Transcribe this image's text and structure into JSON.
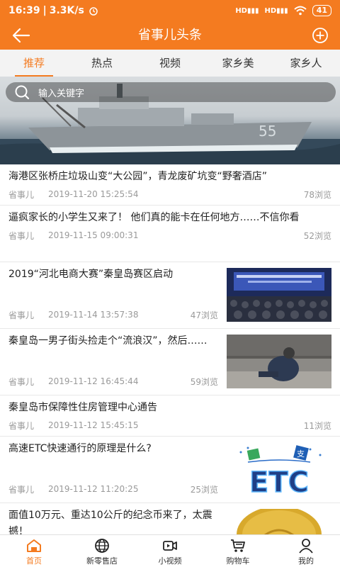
{
  "status": {
    "time": "16:39",
    "speed": "3.3K/s",
    "battery": "41"
  },
  "header": {
    "title": "省事儿头条"
  },
  "tabs": [
    {
      "label": "推荐",
      "active": true
    },
    {
      "label": "热点"
    },
    {
      "label": "视频"
    },
    {
      "label": "家乡美"
    },
    {
      "label": "家乡人"
    }
  ],
  "search": {
    "placeholder": "输入关键字"
  },
  "banner": {
    "ship_number": "55"
  },
  "news": [
    {
      "title": "海港区张桥庄垃圾山变“大公园”，青龙废矿坑变“野奢酒店”",
      "source": "省事儿",
      "date": "2019-11-20 15:25:54",
      "views": "78浏览"
    },
    {
      "title": "逼疯家长的小学生又来了！ 他们真的能卡在任何地方……不信你看",
      "source": "省事儿",
      "date": "2019-11-15 09:00:31",
      "views": "52浏览"
    },
    {
      "title": "2019“河北电商大赛”秦皇岛赛区启动",
      "source": "省事儿",
      "date": "2019-11-14 13:57:38",
      "views": "47浏览",
      "thumb": "conference"
    },
    {
      "title": "秦皇岛一男子街头捡走个“流浪汉”，然后……",
      "source": "省事儿",
      "date": "2019-11-12 16:45:44",
      "views": "59浏览",
      "thumb": "homeless"
    },
    {
      "title": "秦皇岛市保障性住房管理中心通告",
      "source": "省事儿",
      "date": "2019-11-12 15:45:15",
      "views": "11浏览"
    },
    {
      "title": "高速ETC快速通行的原理是什么?",
      "source": "省事儿",
      "date": "2019-11-12 11:20:25",
      "views": "25浏览",
      "thumb": "etc"
    },
    {
      "title": "面值10万元、重达10公斤的纪念币来了，太震撼！",
      "thumb": "coin"
    }
  ],
  "thumb_text": {
    "etc": "ETC",
    "etc_sign": "支"
  },
  "nav": [
    {
      "label": "首页",
      "icon": "home-icon",
      "active": true
    },
    {
      "label": "新零售店",
      "icon": "globe-icon"
    },
    {
      "label": "小视频",
      "icon": "video-icon"
    },
    {
      "label": "购物车",
      "icon": "cart-icon"
    },
    {
      "label": "我的",
      "icon": "user-icon"
    }
  ],
  "colors": {
    "accent": "#f47b20",
    "tab_bg": "#f3f3f3",
    "meta": "#9a9a9a"
  }
}
